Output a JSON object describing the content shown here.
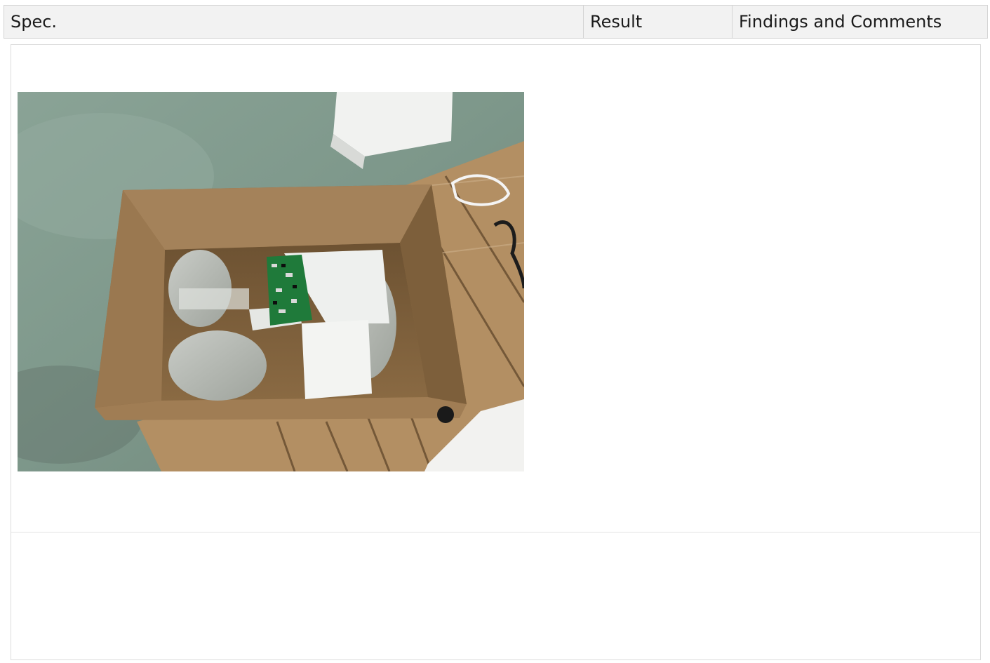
{
  "table": {
    "headers": {
      "spec": "Spec.",
      "result": "Result",
      "findings": "Findings and Comments"
    },
    "photo_icon": "packed-carton-photo",
    "colors": {
      "header_bg": "#f2f2f2",
      "border": "#d4d4d4",
      "floor": "#7f9a8e",
      "cardboard": "#9a7a52",
      "pallet": "#b08d62",
      "pcb_green": "#1f7a3a",
      "foam": "#eef0ee"
    }
  }
}
